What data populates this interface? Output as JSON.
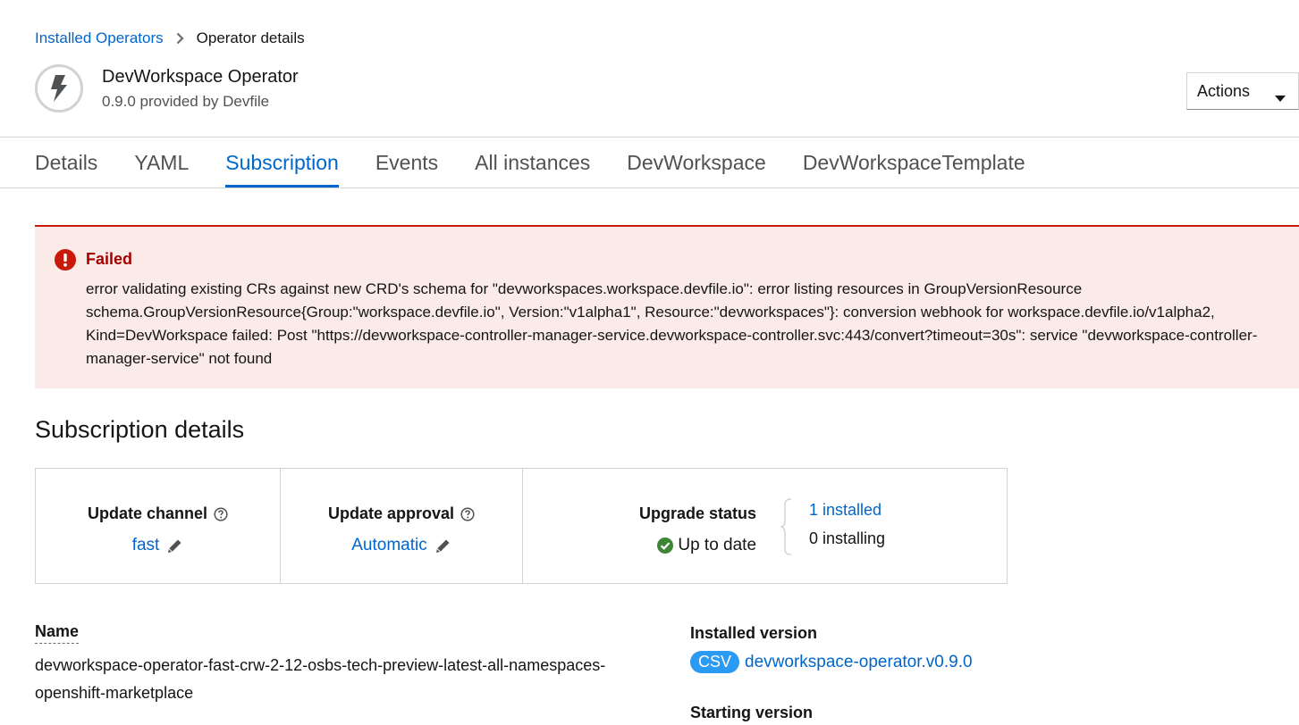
{
  "breadcrumb": {
    "parent": "Installed Operators",
    "current": "Operator details"
  },
  "operator": {
    "name": "DevWorkspace Operator",
    "subtitle": "0.9.0 provided by Devfile",
    "logo_icon": "bolt-icon"
  },
  "actions": {
    "label": "Actions"
  },
  "tabs": [
    {
      "label": "Details",
      "active": false
    },
    {
      "label": "YAML",
      "active": false
    },
    {
      "label": "Subscription",
      "active": true
    },
    {
      "label": "Events",
      "active": false
    },
    {
      "label": "All instances",
      "active": false
    },
    {
      "label": "DevWorkspace",
      "active": false
    },
    {
      "label": "DevWorkspaceTemplate",
      "active": false
    }
  ],
  "alert": {
    "title": "Failed",
    "message": "error validating existing CRs against new CRD's schema for \"devworkspaces.workspace.devfile.io\": error listing resources in GroupVersionResource schema.GroupVersionResource{Group:\"workspace.devfile.io\", Version:\"v1alpha1\", Resource:\"devworkspaces\"}: conversion webhook for workspace.devfile.io/v1alpha2, Kind=DevWorkspace failed: Post \"https://devworkspace-controller-manager-service.devworkspace-controller.svc:443/convert?timeout=30s\": service \"devworkspace-controller-manager-service\" not found"
  },
  "subscription": {
    "title": "Subscription details",
    "update_channel": {
      "label": "Update channel",
      "value": "fast"
    },
    "update_approval": {
      "label": "Update approval",
      "value": "Automatic"
    },
    "upgrade_status": {
      "label": "Upgrade status",
      "status": "Up to date",
      "installed": "1 installed",
      "installing": "0 installing"
    }
  },
  "fields": {
    "name_label": "Name",
    "name_value": "devworkspace-operator-fast-crw-2-12-osbs-tech-preview-latest-all-namespaces-openshift-marketplace",
    "installed_version_label": "Installed version",
    "csv_badge": "CSV",
    "installed_version_value": "devworkspace-operator.v0.9.0",
    "starting_version_label": "Starting version"
  },
  "colors": {
    "link": "#0066cc",
    "danger": "#c9190b",
    "alert_bg": "#faeae8",
    "success": "#3e8635",
    "badge": "#2b9af3"
  }
}
